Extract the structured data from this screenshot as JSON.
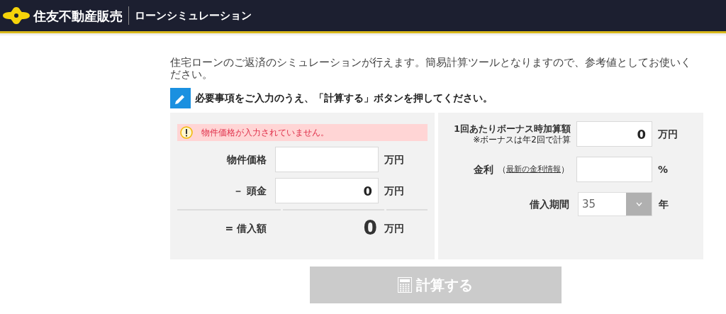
{
  "header": {
    "brand": "住友不動産販売",
    "title": "ローンシミュレーション"
  },
  "intro": "住宅ローンのご返済のシミュレーションが行えます。簡易計算ツールとなりますので、参考値としてお使いください。",
  "instruction": "必要事項をご入力のうえ、「計算する」ボタンを押してください。",
  "left": {
    "error": "物件価格が入力されていません。",
    "fields": [
      {
        "label": "物件価格",
        "unit": "万円"
      },
      {
        "label": "－ 頭金",
        "value": "0",
        "unit": "万円"
      }
    ],
    "total": {
      "label": "= 借入額",
      "value": "0",
      "unit": "万円"
    }
  },
  "right": {
    "bonus": {
      "label": "1回あたりボーナス時加算額",
      "note": "※ボーナスは年2回で計算",
      "value": "0",
      "unit": "万円"
    },
    "rate": {
      "label": "金利",
      "paren_open": "（",
      "link": "最新の金利情報",
      "paren_close": "）",
      "unit": "%"
    },
    "term": {
      "label": "借入期間",
      "value": "35",
      "unit": "年"
    }
  },
  "submit": {
    "label": "計算する",
    "disabled": true
  }
}
